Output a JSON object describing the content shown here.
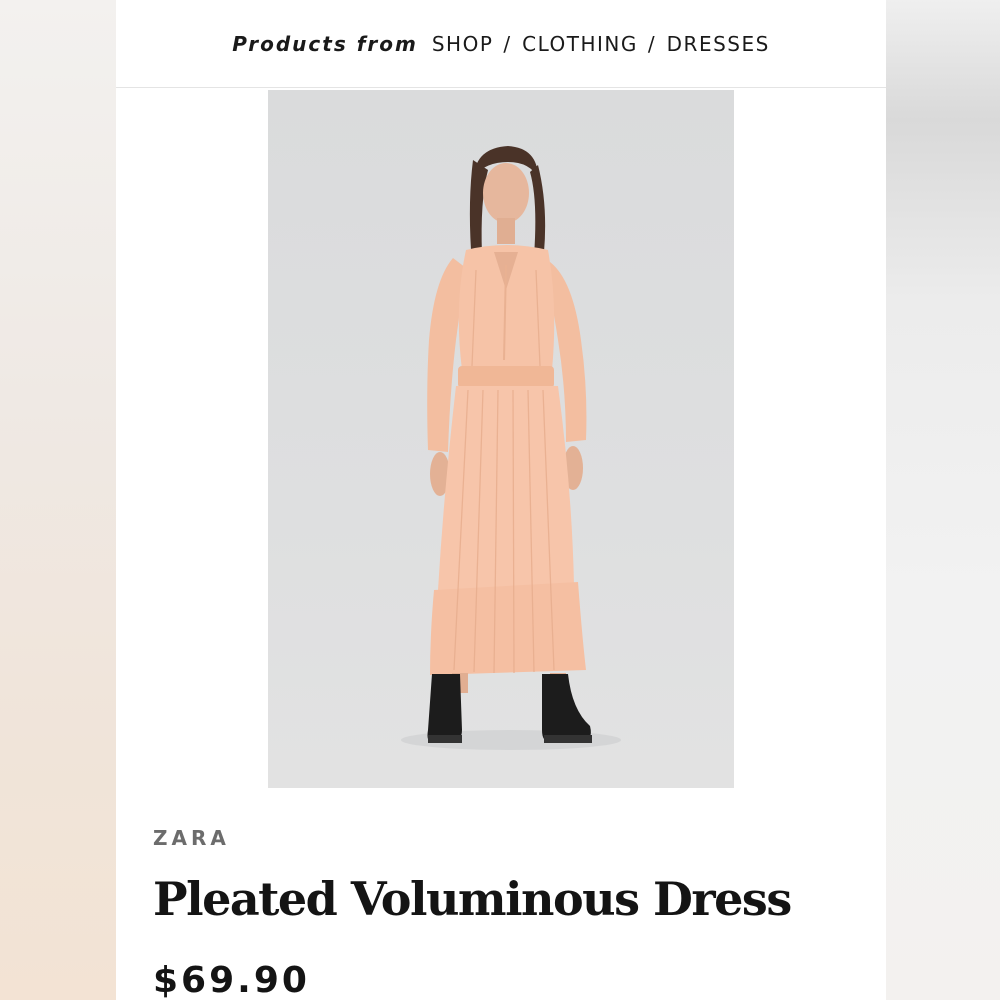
{
  "breadcrumb": {
    "prefix": "Products from",
    "items": [
      {
        "label": "SHOP"
      },
      {
        "label": "CLOTHING"
      },
      {
        "label": "DRESSES"
      }
    ],
    "separator": "/"
  },
  "product": {
    "brand": "ZARA",
    "title": "Pleated Voluminous Dress",
    "price": "$69.90",
    "image": {
      "subject": "model wearing a peach pleated long-sleeve maxi dress with black lace-up boots",
      "dress_color": "#f6c3a7",
      "background_color": "#dcdddd"
    }
  },
  "colors": {
    "page_background": "#ffffff",
    "text_primary": "#141414",
    "text_brand": "#6c6c6c"
  }
}
